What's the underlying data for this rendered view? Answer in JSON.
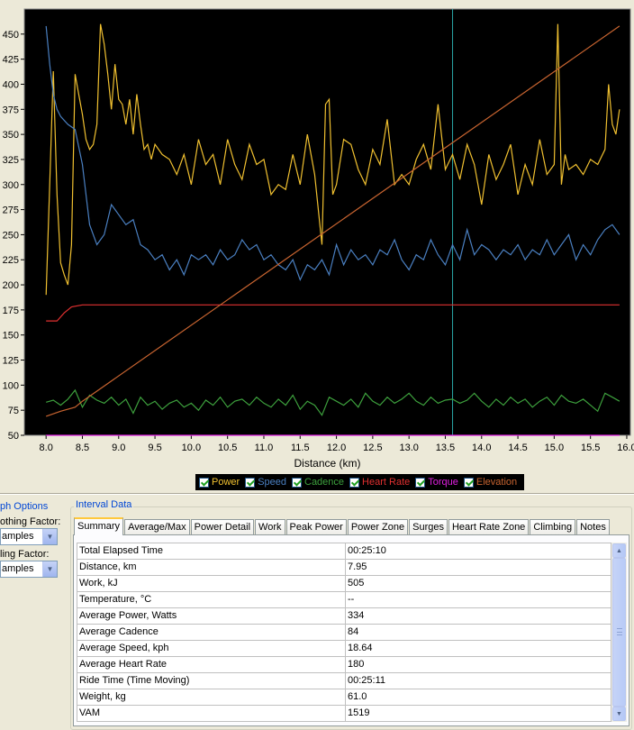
{
  "chart_data": {
    "type": "line",
    "xlabel": "Distance (km)",
    "xlim": [
      7.7,
      16.05
    ],
    "ylim": [
      50,
      475
    ],
    "xticks": [
      "8.0",
      "8.5",
      "9.0",
      "9.5",
      "10.0",
      "10.5",
      "11.0",
      "11.5",
      "12.0",
      "12.5",
      "13.0",
      "13.5",
      "14.0",
      "14.5",
      "15.0",
      "15.5",
      "16.0"
    ],
    "yticks": [
      "50",
      "75",
      "100",
      "125",
      "150",
      "175",
      "200",
      "225",
      "250",
      "275",
      "300",
      "325",
      "350",
      "375",
      "400",
      "425",
      "450"
    ],
    "cursor_x": 13.6,
    "series": [
      {
        "name": "Power",
        "color": "#f0c030",
        "x": [
          8.0,
          8.05,
          8.1,
          8.15,
          8.2,
          8.25,
          8.3,
          8.35,
          8.4,
          8.45,
          8.5,
          8.55,
          8.6,
          8.65,
          8.7,
          8.75,
          8.8,
          8.85,
          8.9,
          8.95,
          9.0,
          9.05,
          9.1,
          9.15,
          9.2,
          9.25,
          9.3,
          9.35,
          9.4,
          9.45,
          9.5,
          9.6,
          9.7,
          9.8,
          9.9,
          10.0,
          10.1,
          10.2,
          10.3,
          10.4,
          10.5,
          10.6,
          10.7,
          10.8,
          10.9,
          11.0,
          11.1,
          11.2,
          11.3,
          11.4,
          11.5,
          11.6,
          11.7,
          11.8,
          11.85,
          11.9,
          11.95,
          12.0,
          12.1,
          12.2,
          12.3,
          12.4,
          12.5,
          12.6,
          12.7,
          12.8,
          12.9,
          13.0,
          13.1,
          13.2,
          13.3,
          13.4,
          13.5,
          13.6,
          13.7,
          13.8,
          13.9,
          14.0,
          14.1,
          14.2,
          14.3,
          14.4,
          14.5,
          14.6,
          14.7,
          14.8,
          14.9,
          15.0,
          15.05,
          15.1,
          15.15,
          15.2,
          15.3,
          15.4,
          15.5,
          15.6,
          15.7,
          15.75,
          15.8,
          15.85,
          15.9
        ],
        "values": [
          190,
          300,
          413,
          290,
          222,
          210,
          200,
          240,
          410,
          390,
          370,
          345,
          335,
          340,
          360,
          460,
          440,
          410,
          375,
          420,
          385,
          380,
          360,
          385,
          350,
          390,
          360,
          335,
          340,
          325,
          340,
          330,
          325,
          310,
          330,
          300,
          345,
          320,
          330,
          300,
          345,
          320,
          305,
          340,
          320,
          325,
          290,
          300,
          295,
          330,
          300,
          350,
          310,
          240,
          380,
          385,
          290,
          300,
          345,
          340,
          315,
          300,
          335,
          320,
          365,
          300,
          310,
          300,
          325,
          340,
          315,
          380,
          315,
          330,
          305,
          340,
          320,
          280,
          330,
          305,
          320,
          340,
          290,
          320,
          300,
          345,
          310,
          320,
          460,
          300,
          330,
          315,
          320,
          310,
          325,
          320,
          335,
          400,
          360,
          350,
          375
        ]
      },
      {
        "name": "Speed",
        "color": "#4a7fc0",
        "x": [
          8.0,
          8.05,
          8.1,
          8.15,
          8.2,
          8.3,
          8.4,
          8.5,
          8.6,
          8.7,
          8.8,
          8.9,
          9.0,
          9.1,
          9.2,
          9.3,
          9.4,
          9.5,
          9.6,
          9.7,
          9.8,
          9.9,
          10.0,
          10.1,
          10.2,
          10.3,
          10.4,
          10.5,
          10.6,
          10.7,
          10.8,
          10.9,
          11.0,
          11.1,
          11.2,
          11.3,
          11.4,
          11.5,
          11.6,
          11.7,
          11.8,
          11.9,
          12.0,
          12.1,
          12.2,
          12.3,
          12.4,
          12.5,
          12.6,
          12.7,
          12.8,
          12.9,
          13.0,
          13.1,
          13.2,
          13.3,
          13.4,
          13.5,
          13.6,
          13.7,
          13.8,
          13.9,
          14.0,
          14.1,
          14.2,
          14.3,
          14.4,
          14.5,
          14.6,
          14.7,
          14.8,
          14.9,
          15.0,
          15.1,
          15.2,
          15.3,
          15.4,
          15.5,
          15.6,
          15.7,
          15.8,
          15.9
        ],
        "values": [
          458,
          420,
          390,
          375,
          368,
          360,
          355,
          320,
          260,
          240,
          250,
          280,
          270,
          260,
          265,
          240,
          235,
          225,
          230,
          215,
          225,
          210,
          230,
          225,
          230,
          220,
          235,
          225,
          230,
          245,
          235,
          240,
          225,
          230,
          220,
          215,
          225,
          205,
          220,
          215,
          225,
          210,
          240,
          220,
          235,
          225,
          230,
          220,
          235,
          230,
          245,
          225,
          215,
          230,
          225,
          245,
          230,
          220,
          240,
          225,
          255,
          230,
          240,
          235,
          225,
          235,
          230,
          240,
          225,
          235,
          230,
          245,
          230,
          240,
          250,
          225,
          240,
          230,
          245,
          255,
          260,
          250
        ]
      },
      {
        "name": "Cadence",
        "color": "#3da03d",
        "x": [
          8.0,
          8.1,
          8.2,
          8.3,
          8.4,
          8.5,
          8.6,
          8.7,
          8.8,
          8.9,
          9.0,
          9.1,
          9.2,
          9.3,
          9.4,
          9.5,
          9.6,
          9.7,
          9.8,
          9.9,
          10.0,
          10.1,
          10.2,
          10.3,
          10.4,
          10.5,
          10.6,
          10.7,
          10.8,
          10.9,
          11.0,
          11.1,
          11.2,
          11.3,
          11.4,
          11.5,
          11.6,
          11.7,
          11.8,
          11.9,
          12.0,
          12.1,
          12.2,
          12.3,
          12.4,
          12.5,
          12.6,
          12.7,
          12.8,
          12.9,
          13.0,
          13.1,
          13.2,
          13.3,
          13.4,
          13.5,
          13.6,
          13.7,
          13.8,
          13.9,
          14.0,
          14.1,
          14.2,
          14.3,
          14.4,
          14.5,
          14.6,
          14.7,
          14.8,
          14.9,
          15.0,
          15.1,
          15.2,
          15.3,
          15.4,
          15.5,
          15.6,
          15.7,
          15.8,
          15.9
        ],
        "values": [
          83,
          85,
          80,
          86,
          95,
          78,
          90,
          85,
          82,
          88,
          80,
          86,
          72,
          88,
          80,
          84,
          76,
          82,
          85,
          78,
          82,
          75,
          85,
          80,
          88,
          78,
          84,
          86,
          80,
          88,
          82,
          78,
          86,
          80,
          90,
          76,
          84,
          80,
          70,
          88,
          84,
          80,
          86,
          78,
          92,
          84,
          80,
          88,
          82,
          86,
          92,
          84,
          80,
          88,
          82,
          85,
          86,
          82,
          85,
          92,
          84,
          78,
          86,
          80,
          88,
          82,
          86,
          78,
          84,
          88,
          80,
          90,
          84,
          82,
          86,
          80,
          74,
          92,
          88,
          84
        ]
      },
      {
        "name": "Heart Rate",
        "color": "#e03030",
        "x": [
          8.0,
          8.15,
          8.25,
          8.35,
          8.5,
          9.0,
          10.0,
          11.0,
          12.0,
          13.0,
          14.0,
          15.0,
          15.9
        ],
        "values": [
          164,
          164,
          172,
          178,
          180,
          180,
          180,
          180,
          180,
          180,
          180,
          180,
          180
        ]
      },
      {
        "name": "Elevation",
        "color": "#c86430",
        "x": [
          8.0,
          8.2,
          8.4,
          8.5,
          15.9
        ],
        "values": [
          69,
          74,
          78,
          84,
          458
        ]
      },
      {
        "name": "Torque",
        "color": "#e020e0",
        "x": [
          8.0,
          15.9
        ],
        "values": [
          50,
          50
        ]
      }
    ]
  },
  "legend": [
    {
      "label": "Power",
      "color": "#f0c030"
    },
    {
      "label": "Speed",
      "color": "#4a7fc0"
    },
    {
      "label": "Cadence",
      "color": "#3da03d"
    },
    {
      "label": "Heart Rate",
      "color": "#e03030"
    },
    {
      "label": "Torque",
      "color": "#e020e0"
    },
    {
      "label": "Elevation",
      "color": "#c86430"
    }
  ],
  "graph_options": {
    "title": "ph Options",
    "smoothing_label": "othing Factor:",
    "smoothing_value": "amples",
    "sampling_label": "ling Factor:",
    "sampling_value": "amples"
  },
  "interval": {
    "title": "Interval Data",
    "tabs": [
      "Summary",
      "Average/Max",
      "Power Detail",
      "Work",
      "Peak Power",
      "Power Zone",
      "Surges",
      "Heart Rate Zone",
      "Climbing",
      "Notes"
    ],
    "active_tab": "Summary",
    "rows": [
      {
        "label": "Total Elapsed Time",
        "value": "00:25:10"
      },
      {
        "label": "Distance, km",
        "value": "7.95"
      },
      {
        "label": "Work, kJ",
        "value": "505"
      },
      {
        "label": "Temperature, °C",
        "value": "--"
      },
      {
        "label": "Average Power, Watts",
        "value": "334"
      },
      {
        "label": "Average Cadence",
        "value": "84"
      },
      {
        "label": "Average Speed, kph",
        "value": "18.64"
      },
      {
        "label": "Average Heart Rate",
        "value": "180"
      },
      {
        "label": "Ride Time (Time Moving)",
        "value": "00:25:11"
      },
      {
        "label": "Weight, kg",
        "value": "61.0"
      },
      {
        "label": "VAM",
        "value": "1519"
      }
    ]
  }
}
